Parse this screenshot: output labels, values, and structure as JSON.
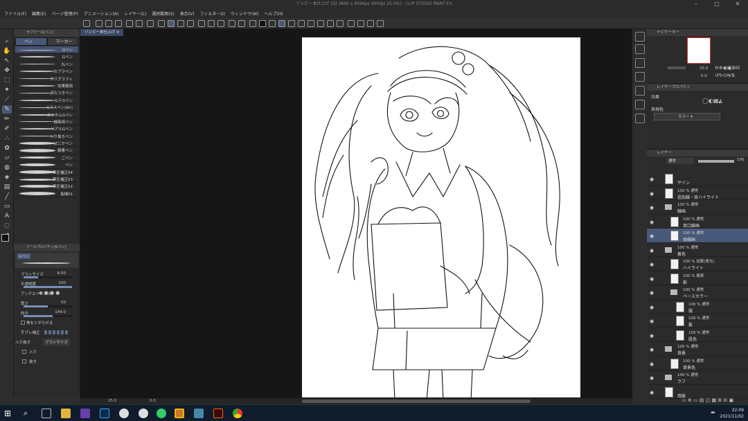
{
  "window": {
    "title": "ゾンビー本仕上げ (Q) 3840 x 4096px 400dpi 25.0%) - CLIP STUDIO PAINT EX"
  },
  "menu": [
    "ファイル(F)",
    "編集(E)",
    "ページ管理(P)",
    "アニメーション(A)",
    "レイヤー(L)",
    "選択範囲(S)",
    "表示(V)",
    "フィルター(I)",
    "ウィンドウ(W)",
    "ヘルプ(H)"
  ],
  "subtool": {
    "header": "サブツール[ペン]",
    "tabs": [
      "ペン",
      "マーカー"
    ],
    "brushes": [
      "Gペン",
      "Gペン",
      "丸ペン",
      "カブラペン",
      "カリグラフィ",
      "効果線用",
      "ざらつきペン",
      "Gラスペン",
      "Gラスペン(Air)",
      "カスタムGペン",
      "線画用ペン",
      "リアルGペン",
      "入り抜きペン",
      "ぼこかペン",
      "線書ペン",
      "ごペン",
      "ペン",
      "筆圧補正04",
      "筆圧補正03",
      "筆圧補正02",
      "長細01"
    ],
    "selected_index": 0
  },
  "toolprop": {
    "header": "ツールプロパティ[Gペン]",
    "preview_label": "Gペン",
    "brush_size_label": "ブラシサイズ",
    "brush_size": "6.50",
    "opacity_label": "不透明度",
    "opacity": "100",
    "aa_label": "アンチエイリアス",
    "thickness_label": "厚さ",
    "thickness": "50",
    "direction_label": "向き",
    "direction": "149.0",
    "sharp_label": "角をとがらせる",
    "stabilize_label": "手ブレ補正",
    "taper_label": "入り抜き",
    "taper_value": "ブラシサイズ",
    "in_label": "入り",
    "out_label": "抜き"
  },
  "doc_tab": "ゾンビー本仕上げ",
  "status": {
    "zoom": "25.0",
    "angle": "0.0"
  },
  "navigator": {
    "tabs": "ナビゲーター",
    "zoom": "25.0",
    "angle": "0.0"
  },
  "layerprop": {
    "header": "レイヤープロパティ",
    "effect_label": "効果",
    "color_label": "表現色",
    "color_value": "カラー"
  },
  "layers": {
    "header": "レイヤー",
    "blend_mode": "通常",
    "opacity": "100",
    "items": [
      {
        "mode": "",
        "name": "サイン",
        "folder": false,
        "indent": 0,
        "sel": false
      },
      {
        "mode": "100 % 通常",
        "name": "追加線・目ハイライト",
        "folder": false,
        "indent": 0,
        "sel": false
      },
      {
        "mode": "100 % 通常",
        "name": "線画",
        "folder": true,
        "indent": 0,
        "sel": false
      },
      {
        "mode": "100 % 通常",
        "name": "目口線画",
        "folder": false,
        "indent": 1,
        "sel": false
      },
      {
        "mode": "100 % 通常",
        "name": "体線画",
        "folder": false,
        "indent": 1,
        "sel": true
      },
      {
        "mode": "100 % 通常",
        "name": "着色",
        "folder": true,
        "indent": 0,
        "sel": false
      },
      {
        "mode": "100 % 加算(発光)",
        "name": "ハイライト",
        "folder": false,
        "indent": 1,
        "sel": false
      },
      {
        "mode": "100 % 乗算",
        "name": "影",
        "folder": false,
        "indent": 1,
        "sel": false
      },
      {
        "mode": "100 % 通常",
        "name": "ベースカラー",
        "folder": true,
        "indent": 1,
        "sel": false
      },
      {
        "mode": "100 % 通常",
        "name": "服",
        "folder": false,
        "indent": 2,
        "sel": false
      },
      {
        "mode": "100 % 通常",
        "name": "髪",
        "folder": false,
        "indent": 2,
        "sel": false
      },
      {
        "mode": "100 % 通常",
        "name": "肌色",
        "folder": false,
        "indent": 2,
        "sel": false
      },
      {
        "mode": "100 % 通常",
        "name": "背景",
        "folder": true,
        "indent": 0,
        "sel": false
      },
      {
        "mode": "100 % 通常",
        "name": "背景色",
        "folder": false,
        "indent": 1,
        "sel": false
      },
      {
        "mode": "100 % 通常",
        "name": "ラフ",
        "folder": true,
        "indent": 0,
        "sel": false
      },
      {
        "mode": "",
        "name": "用紙",
        "folder": false,
        "indent": 0,
        "sel": false
      }
    ]
  },
  "clock": {
    "time": "22:09",
    "date": "2021/11/02"
  },
  "colors": {
    "accent": "#48587a",
    "panel": "#2b2b2b"
  }
}
